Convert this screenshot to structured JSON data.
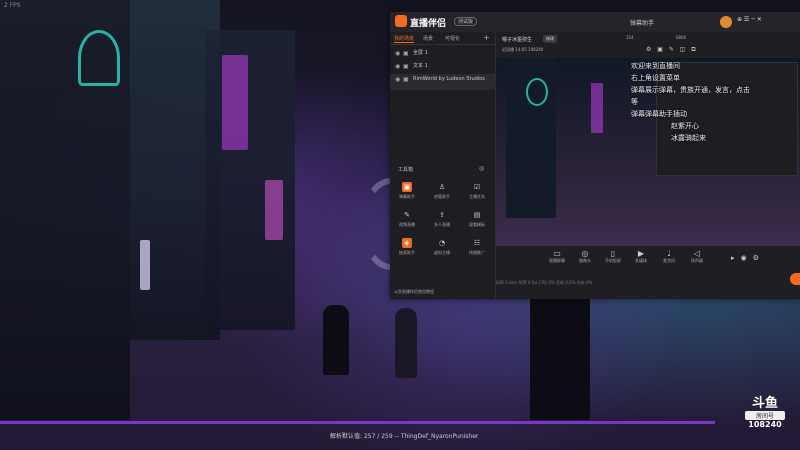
{
  "overlay": {
    "fps": "2 FPS"
  },
  "app": {
    "name": "直播伴侣",
    "version_badge": "测试版",
    "window_title": "弹幕助手",
    "titlebar_icons": "⊕ ☰ ─ ✕",
    "tabs": [
      {
        "label": "我的场景"
      },
      {
        "label": "场景"
      },
      {
        "label": "可视化"
      }
    ],
    "sources": [
      {
        "name": "全屏 1"
      },
      {
        "name": "文本 1"
      },
      {
        "name": "RimWorld by Ludeon Studios"
      }
    ],
    "tools_header": "工具箱",
    "tools": [
      {
        "label": "弹幕助手",
        "icon": "chat-icon",
        "color": "#f36b21"
      },
      {
        "label": "房管助手",
        "icon": "user-icon",
        "color": "#555"
      },
      {
        "label": "主播任务",
        "icon": "task-icon",
        "color": "#555"
      },
      {
        "label": "视频直播",
        "icon": "video-icon",
        "color": "#555"
      },
      {
        "label": "多人直播",
        "icon": "upload-icon",
        "color": "#555"
      },
      {
        "label": "观看模板",
        "icon": "template-icon",
        "color": "#555"
      },
      {
        "label": "抽奖助手",
        "icon": "gift-icon",
        "color": "#f36b21"
      },
      {
        "label": "虚拟主播",
        "icon": "avatar-icon",
        "color": "#555"
      },
      {
        "label": "快捷推广",
        "icon": "promote-icon",
        "color": "#555"
      }
    ],
    "left_footer": "斗鱼直播伴侣使用教程",
    "main": {
      "title": "嗯子冰墨弥生",
      "badge": "修改",
      "stats": "近段播 14:05  108240",
      "counts": [
        "154",
        "6866"
      ],
      "chat_lines": [
        "欢迎来到直播间",
        "右上角设置菜单",
        "弹幕展示弹幕，贵族开通，发言，点击",
        "等",
        "弹幕弹幕助手插动",
        "赵紫开心",
        "冰露骑起来"
      ],
      "controls": [
        {
          "label": "直播屏幕",
          "icon": "screen-icon"
        },
        {
          "label": "摄像头",
          "icon": "camera-icon"
        },
        {
          "label": "手机投屏",
          "icon": "phone-icon"
        },
        {
          "label": "多媒体",
          "icon": "media-icon"
        },
        {
          "label": "麦克风",
          "icon": "mic-icon"
        },
        {
          "label": "扬声器",
          "icon": "speaker-icon"
        }
      ],
      "status_text": "码率 0 kb/s   帧率 0 fps   CPU 0%   丢帧 0.0%   内存 0%"
    }
  },
  "game": {
    "bottom_status": "解析默认值: 257 / 259 -- ThingDef_NyaronPunisher",
    "douyu_logo": "斗鱼",
    "room_label": "房间号",
    "room_number": "108240"
  }
}
